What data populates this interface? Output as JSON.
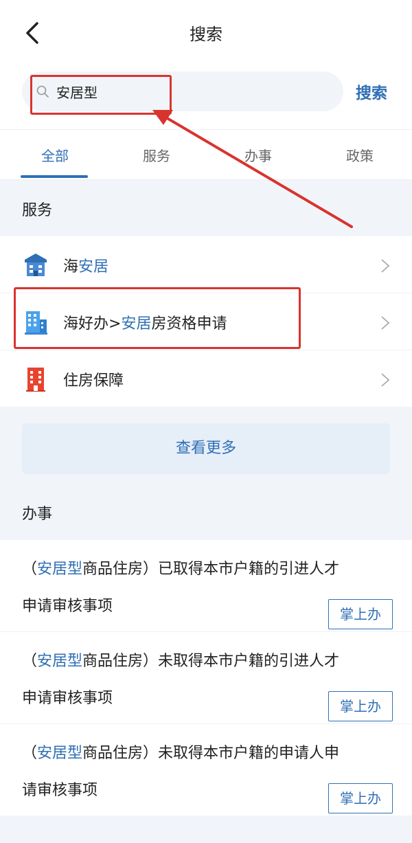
{
  "header": {
    "title": "搜索"
  },
  "search": {
    "value": "安居型",
    "button_label": "搜索"
  },
  "tabs": [
    {
      "label": "全部",
      "active": true
    },
    {
      "label": "服务",
      "active": false
    },
    {
      "label": "办事",
      "active": false
    },
    {
      "label": "政策",
      "active": false
    }
  ],
  "services": {
    "heading": "服务",
    "items": [
      {
        "pre": "海",
        "highlight": "安居",
        "post": "",
        "icon": "building-blue-icon"
      },
      {
        "pre": "海好办>",
        "highlight": "安居",
        "post": "房资格申请",
        "icon": "office-building-icon"
      },
      {
        "pre": "住房保障",
        "highlight": "",
        "post": "",
        "icon": "building-red-icon"
      }
    ],
    "more_label": "查看更多"
  },
  "matters": {
    "heading": "办事",
    "items": [
      {
        "open": "（",
        "highlight": "安居型",
        "line1_rest": "商品住房）已取得本市户籍的引进人才",
        "line2": "申请审核事项",
        "button": "掌上办"
      },
      {
        "open": "（",
        "highlight": "安居型",
        "line1_rest": "商品住房）未取得本市户籍的引进人才",
        "line2": "申请审核事项",
        "button": "掌上办"
      },
      {
        "open": "（",
        "highlight": "安居型",
        "line1_rest": "商品住房）未取得本市户籍的申请人申",
        "line2": "请审核事项",
        "button": "掌上办"
      }
    ]
  },
  "colors": {
    "accent": "#2f6fb5",
    "annotation": "#d9332e",
    "page_bg": "#f1f5fa"
  }
}
